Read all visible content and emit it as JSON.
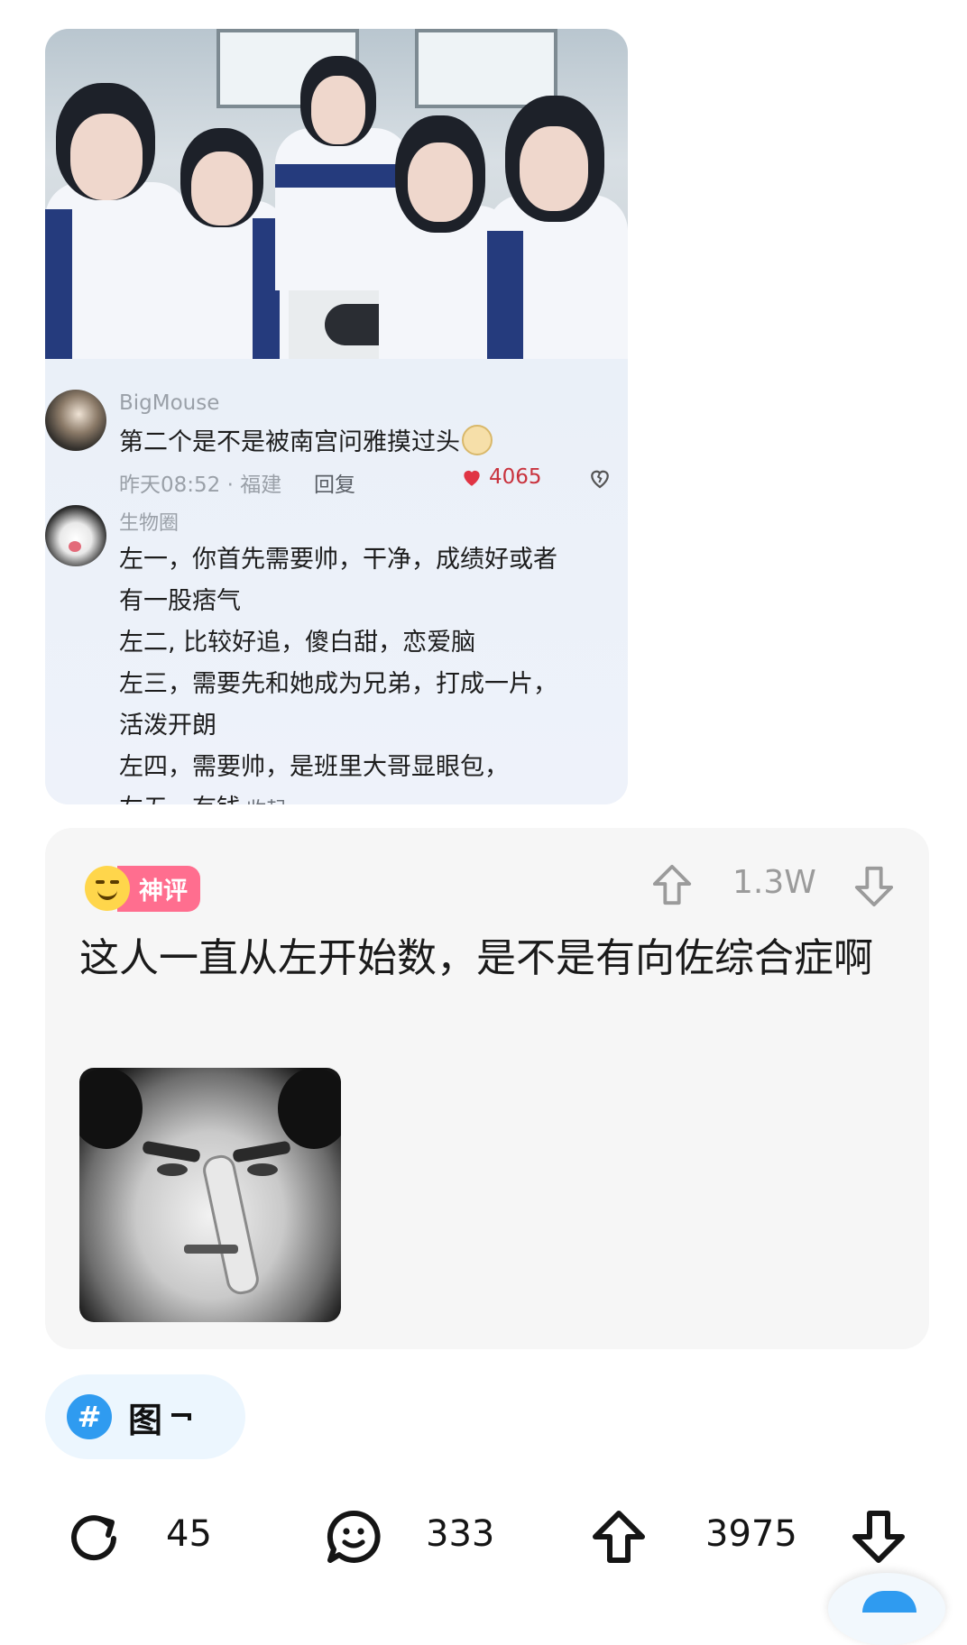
{
  "screenshot": {
    "comment1": {
      "username": "BigMouse",
      "text": "第二个是不是被南宫问雅摸过头",
      "time_location": "昨天08:52 · 福建",
      "reply_label": "回复",
      "like_count": "4065"
    },
    "comment2": {
      "username": "生物圈",
      "lines": [
        "左一，你首先需要帅，干净，成绩好或者",
        "有一股痞气",
        "左二, 比较好追，傻白甜，恋爱脑",
        "左三，需要先和她成为兄弟，打成一片，",
        "活泼开朗",
        "左四，需要帅，是班里大哥显眼包，",
        "左五，有钱"
      ],
      "collapse_label": "收起"
    }
  },
  "god_comment": {
    "badge_label": "神评",
    "vote_count": "1.3W",
    "text": "这人一直从左开始数，是不是有向佐综合症啊"
  },
  "topic": {
    "hash_symbol": "#",
    "label": "图"
  },
  "actions": {
    "share_count": "45",
    "comment_count": "333",
    "upvote_count": "3975"
  },
  "colors": {
    "god_badge": "#ff6e8f",
    "topic_hash": "#2f9bf0",
    "like_red": "#c9323d"
  }
}
